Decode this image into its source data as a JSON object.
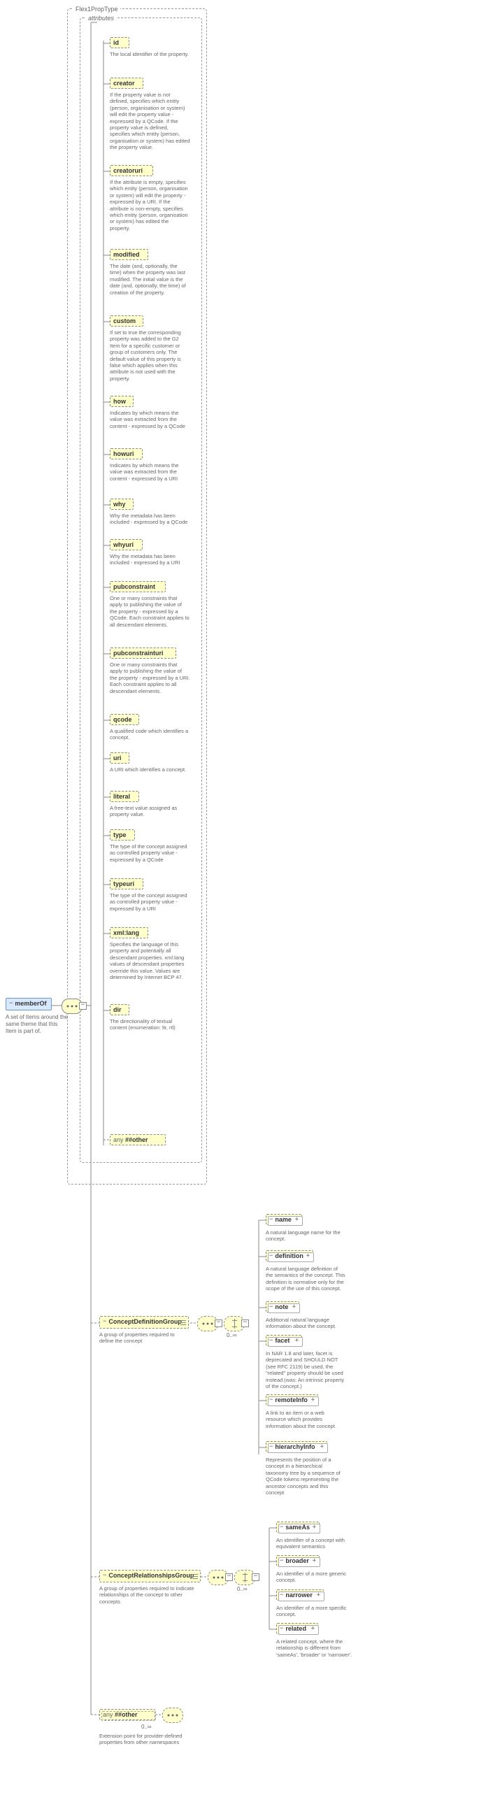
{
  "outer_label": "Flex1PropType",
  "attributes_box_label": "attributes",
  "memberOf": {
    "label": "memberOf",
    "desc": "A set of Items around the same theme that this Item is part of."
  },
  "attrs": [
    {
      "name": "id",
      "desc": "The local identifier of the property."
    },
    {
      "name": "creator",
      "desc": "If the property value is not defined, specifies which entity (person, organisation or system) will edit the property value - expressed by a QCode. If the property value is defined, specifies which entity (person, organisation or system) has edited the property value."
    },
    {
      "name": "creatoruri",
      "desc": "If the attribute is empty, specifies which entity (person, organisation or system) will edit the property - expressed by a URI. If the attribute is non-empty, specifies which entity (person, organisation or system) has edited the property."
    },
    {
      "name": "modified",
      "desc": "The date (and, optionally, the time) when the property was last modified. The initial value is the date (and, optionally, the time) of creation of the property."
    },
    {
      "name": "custom",
      "desc": "If set to true the corresponding property was added to the G2 Item for a specific customer or group of customers only. The default value of this property is false which applies when this attribute is not used with the property."
    },
    {
      "name": "how",
      "desc": "Indicates by which means the value was extracted from the content - expressed by a QCode"
    },
    {
      "name": "howuri",
      "desc": "Indicates by which means the value was extracted from the content - expressed by a URI"
    },
    {
      "name": "why",
      "desc": "Why the metadata has been included - expressed by a QCode"
    },
    {
      "name": "whyuri",
      "desc": "Why the metadata has been included - expressed by a URI"
    },
    {
      "name": "pubconstraint",
      "desc": "One or many constraints that apply to publishing the value of the property - expressed by a QCode. Each constraint applies to all descendant elements."
    },
    {
      "name": "pubconstrainturi",
      "desc": "One or many constraints that apply to publishing the value of the property - expressed by a URI. Each constraint applies to all descendant elements."
    },
    {
      "name": "qcode",
      "desc": "A qualified code which identifies a concept."
    },
    {
      "name": "uri",
      "desc": "A URI which identifies a concept."
    },
    {
      "name": "literal",
      "desc": "A free-text value assigned as property value."
    },
    {
      "name": "type",
      "desc": "The type of the concept assigned as controlled property value - expressed by a QCode"
    },
    {
      "name": "typeuri",
      "desc": "The type of the concept assigned as controlled property value - expressed by a URI"
    },
    {
      "name": "xml:lang",
      "desc": "Specifies the language of this property and potentially all descendant properties. xml:lang values of descendant properties override this value. Values are determined by Internet BCP 47."
    },
    {
      "name": "dir",
      "desc": "The directionality of textual content (enumeration: ltr, rtl)"
    }
  ],
  "any_attr": "##other",
  "groups": {
    "cdg": {
      "label": "ConceptDefinitionGroup",
      "desc": "A group of properties required to define the concept"
    },
    "crg": {
      "label": "ConceptRelationshipsGroup",
      "desc": "A group of properties required to indicate relationships of the concept to other concepts"
    }
  },
  "cdg_children": [
    {
      "name": "name",
      "desc": "A natural language name for the concept."
    },
    {
      "name": "definition",
      "desc": "A natural language definition of the semantics of the concept. This definition is normative only for the scope of the use of this concept."
    },
    {
      "name": "note",
      "desc": "Additional natural language information about the concept."
    },
    {
      "name": "facet",
      "desc": "In NAR 1.8 and later, facet is deprecated and SHOULD NOT (see RFC 2119) be used, the \"related\" property should be used instead.(was: An intrinsic property of the concept.)"
    },
    {
      "name": "remoteInfo",
      "desc": "A link to an item or a web resource which provides information about the concept."
    },
    {
      "name": "hierarchyInfo",
      "desc": "Represents the position of a concept in a hierarchical taxonomy tree by a sequence of QCode tokens representing the ancestor concepts and this concept"
    }
  ],
  "crg_children": [
    {
      "name": "sameAs",
      "desc": "An identifier of a concept with equivalent semantics"
    },
    {
      "name": "broader",
      "desc": "An identifier of a more generic concept."
    },
    {
      "name": "narrower",
      "desc": "An identifier of a more specific concept."
    },
    {
      "name": "related",
      "desc": "A related concept, where the relationship is different from 'sameAs', 'broader' or 'narrower'."
    }
  ],
  "ext_any": {
    "prefix": "any",
    "ns": "##other",
    "desc": "Extension point for provider-defined properties from other namespaces"
  },
  "occ": "0..∞"
}
